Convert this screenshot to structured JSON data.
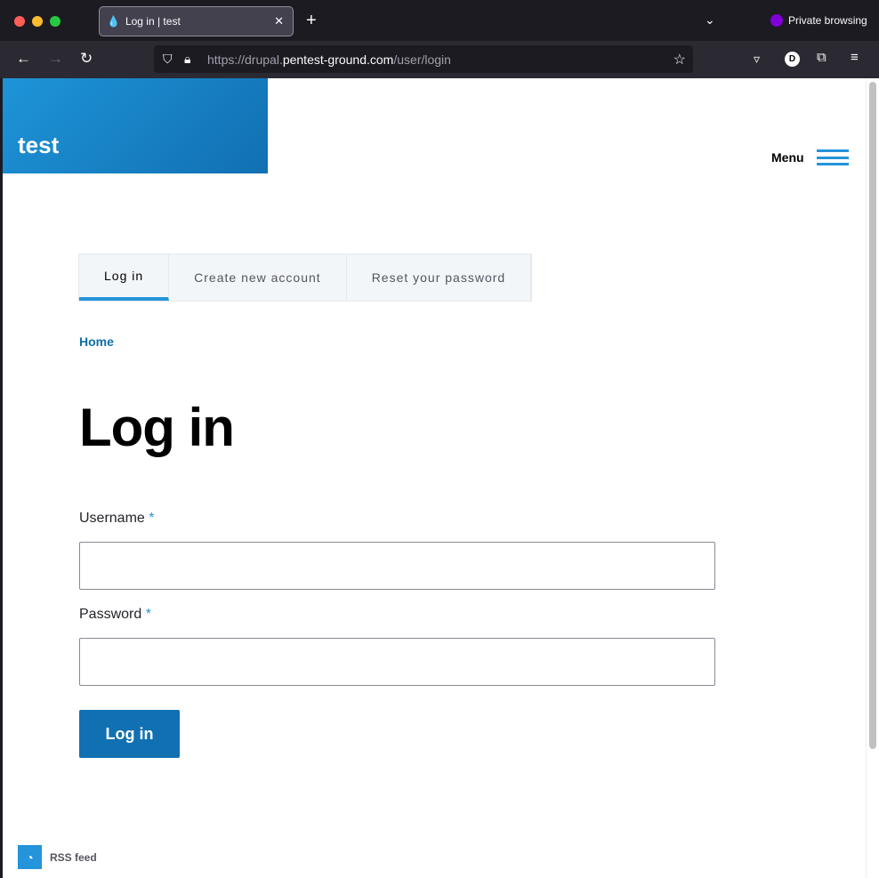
{
  "browser": {
    "tab_title": "Log in | test",
    "private_label": "Private browsing",
    "url_prefix": "https://drupal.",
    "url_domain": "pentest-ground.com",
    "url_path": "/user/login",
    "profile_initial": "D"
  },
  "site": {
    "name": "test",
    "menu_label": "Menu"
  },
  "tabs": [
    {
      "label": "Log in",
      "active": true
    },
    {
      "label": "Create new account"
    },
    {
      "label": "Reset your password"
    }
  ],
  "breadcrumb": {
    "home": "Home"
  },
  "page_title": "Log in",
  "form": {
    "username_label": "Username",
    "password_label": "Password",
    "required_mark": "*",
    "username_value": "",
    "password_value": "",
    "submit_label": "Log in"
  },
  "footer": {
    "rss_label": "RSS feed"
  },
  "colors": {
    "accent": "#2494db",
    "button": "#1170b2",
    "link": "#0f6fa8"
  }
}
